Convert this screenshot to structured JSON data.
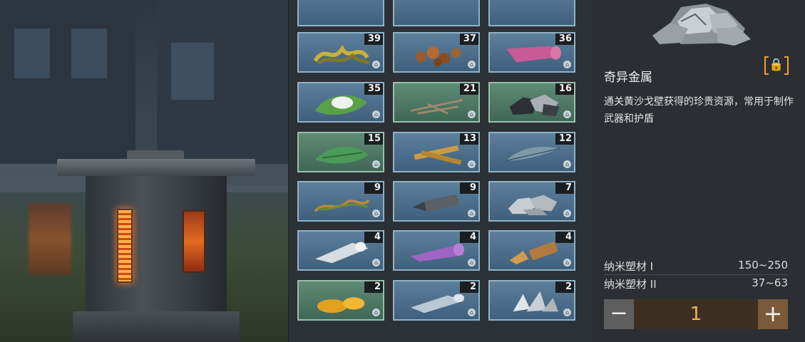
{
  "inventory": {
    "items": [
      {
        "count": "",
        "icon": "item-partial-1",
        "tint": "blue"
      },
      {
        "count": "",
        "icon": "item-partial-2",
        "tint": "blue"
      },
      {
        "count": "",
        "icon": "item-partial-3",
        "tint": "blue"
      },
      {
        "count": "39",
        "icon": "seaweed-icon",
        "tint": "blue"
      },
      {
        "count": "37",
        "icon": "nuts-icon",
        "tint": "blue"
      },
      {
        "count": "36",
        "icon": "pink-cloth-icon",
        "tint": "blue"
      },
      {
        "count": "35",
        "icon": "cotton-leaf-icon",
        "tint": "blue"
      },
      {
        "count": "21",
        "icon": "twigs-icon",
        "tint": "green"
      },
      {
        "count": "16",
        "icon": "ore-chunks-icon",
        "tint": "green"
      },
      {
        "count": "15",
        "icon": "green-leaves-icon",
        "tint": "green"
      },
      {
        "count": "13",
        "icon": "wood-planks-icon",
        "tint": "blue"
      },
      {
        "count": "12",
        "icon": "feathers-icon",
        "tint": "blue"
      },
      {
        "count": "9",
        "icon": "vines-icon",
        "tint": "blue"
      },
      {
        "count": "9",
        "icon": "drill-part-icon",
        "tint": "blue"
      },
      {
        "count": "7",
        "icon": "strange-metal-icon",
        "tint": "blue"
      },
      {
        "count": "4",
        "icon": "white-cloth-icon",
        "tint": "blue"
      },
      {
        "count": "4",
        "icon": "purple-cloth-icon",
        "tint": "blue"
      },
      {
        "count": "4",
        "icon": "copper-part-icon",
        "tint": "blue"
      },
      {
        "count": "2",
        "icon": "amber-icon",
        "tint": "green"
      },
      {
        "count": "2",
        "icon": "blue-cloth-icon",
        "tint": "blue"
      },
      {
        "count": "2",
        "icon": "crystal-icon",
        "tint": "blue"
      }
    ]
  },
  "detail": {
    "image_icon": "strange-metal-icon",
    "name": "奇异金属",
    "lock_icon": "padlock-icon",
    "description": "通关黄沙戈壁获得的珍贵资源，常用于制作武器和护盾",
    "stats": [
      {
        "label": "纳米塑材 I",
        "value": "150~250"
      },
      {
        "label": "纳米塑材 II",
        "value": "37~63"
      }
    ],
    "quantity": {
      "minus": "−",
      "value": "1",
      "plus": "+"
    }
  },
  "colors": {
    "slot_blue": "#4f7390",
    "slot_green": "#527a68",
    "accent": "#f0a030",
    "qty_text": "#f5b252"
  }
}
